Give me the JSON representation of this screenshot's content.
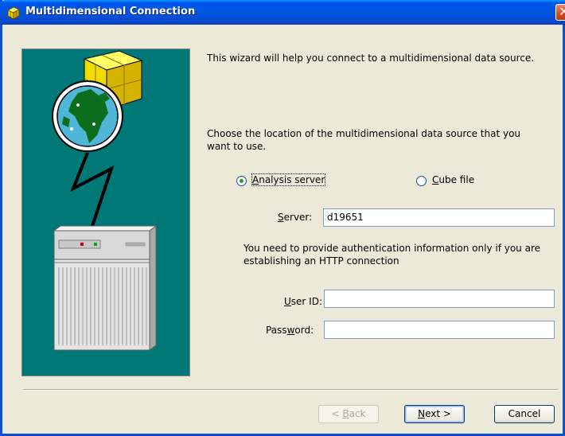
{
  "window": {
    "title": "Multidimensional Connection"
  },
  "content": {
    "intro": "This wizard will help you connect to a multidimensional data source.",
    "choose_line1": "Choose the location of the multidimensional data source that you",
    "choose_line2": "want to use.",
    "radio_analysis_server": {
      "label": "Analysis server",
      "checked": true
    },
    "radio_cube_file": {
      "label": "Cube file",
      "checked": false
    },
    "server": {
      "label": "Server:",
      "value": "d19651"
    },
    "auth_line1": "You need to provide authentication information only if you are",
    "auth_line2": "establishing an HTTP connection",
    "user_id": {
      "label": "User ID:",
      "value": ""
    },
    "password": {
      "label": "Password:",
      "value": ""
    }
  },
  "buttons": {
    "back": "< Back",
    "next": "Next >",
    "cancel": "Cancel"
  },
  "colors": {
    "art_background": "#007878",
    "title_bar": "#0055e5",
    "dialog_background": "#ece9d8"
  },
  "icons": {
    "title": "cube-icon",
    "close": "close-icon",
    "illustration": "globe-cube-lightning-server-illustration"
  }
}
